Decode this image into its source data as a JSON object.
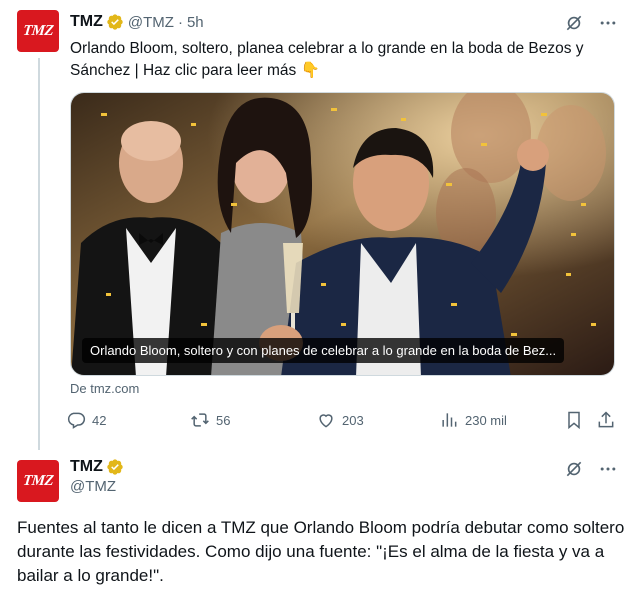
{
  "colors": {
    "text_primary": "#0f1419",
    "text_secondary": "#536471",
    "verified_gold": "#e2b719",
    "brand_red": "#d9181f",
    "divider": "#cfd9de"
  },
  "tweet1": {
    "avatar_text": "TMZ",
    "display_name": "TMZ",
    "handle": "@TMZ",
    "separator": "·",
    "time": "5h",
    "icons": [
      "verified-badge-icon",
      "grok-icon",
      "more-icon"
    ],
    "text": "Orlando Bloom, soltero, planea celebrar a lo grande en la boda de Bezos y Sánchez | Haz clic para leer más 👇",
    "media": {
      "caption": "Orlando Bloom, soltero y con planes de celebrar a lo grande en la boda de Bez..."
    },
    "source": "De tmz.com",
    "actions": {
      "replies": "42",
      "reposts": "56",
      "likes": "203",
      "views": "230 mil"
    }
  },
  "tweet2": {
    "avatar_text": "TMZ",
    "display_name": "TMZ",
    "handle": "@TMZ",
    "text": "Fuentes al tanto le dicen a TMZ que Orlando Bloom podría debutar como soltero durante las festividades. Como dijo una fuente: \"¡Es el alma de la fiesta y va a bailar a lo grande!\"."
  }
}
